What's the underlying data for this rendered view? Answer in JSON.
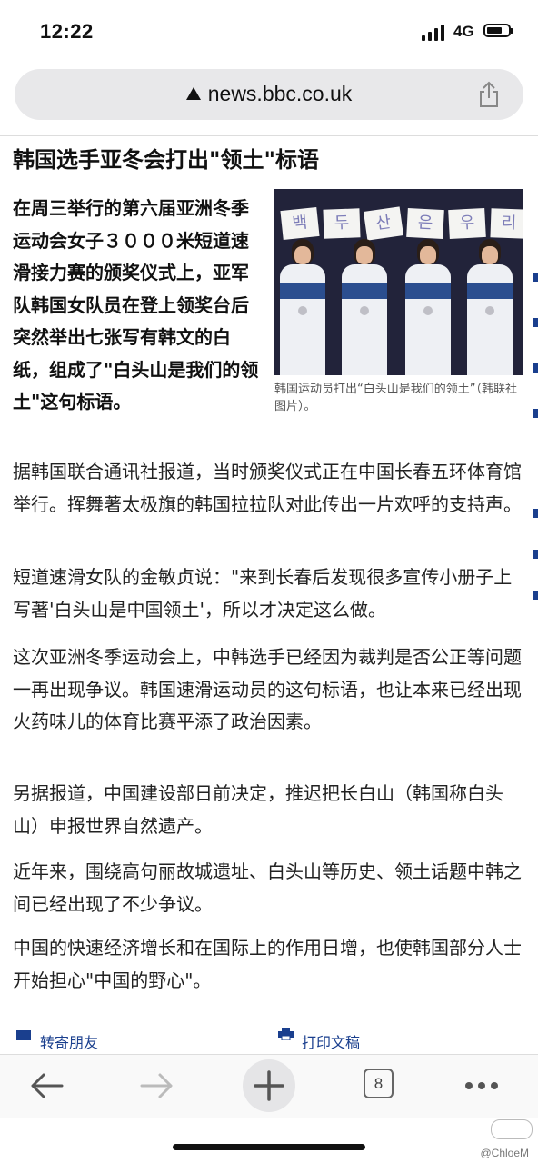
{
  "status_bar": {
    "time": "12:22",
    "network": "4G"
  },
  "browser": {
    "url": "news.bbc.co.uk",
    "open_tabs": "8"
  },
  "article": {
    "title": "韩国选手亚冬会打出\"领土\"标语",
    "lead": "在周三举行的第六届亚洲冬季运动会女子３０００米短道速滑接力赛的颁奖仪式上，亚军队韩国女队员在登上领奖台后突然举出七张写有韩文的白纸，组成了\"白头山是我们的领土\"这句标语。",
    "photo": {
      "banner_chars": [
        "백",
        "두",
        "산",
        "은",
        "우",
        "리"
      ],
      "caption": "韩国运动员打出“白头山是我们的领土”（韩联社图片）。"
    },
    "paragraphs": [
      "据韩国联合通讯社报道，当时颁奖仪式正在中国长春五环体育馆举行。挥舞著太极旗的韩国拉拉队对此传出一片欢呼的支持声。",
      "短道速滑女队的金敏贞说：\"来到长春后发现很多宣传小册子上写著'白头山是中国领土'，所以才决定这么做。",
      "这次亚洲冬季运动会上，中韩选手已经因为裁判是否公正等问题一再出现争议。韩国速滑运动员的这句标语，也让本来已经出现火药味儿的体育比赛平添了政治因素。",
      "另据报道，中国建设部日前决定，推迟把长白山（韩国称白头山）申报世界自然遗产。",
      "近年来，围绕高句丽故城遗址、白头山等历史、领土话题中韩之间已经出现了不少争议。",
      "中国的快速经济增长和在国际上的作用日增，也使韩国部分人士开始担心\"中国的野心\"。"
    ],
    "links": {
      "forward": "转寄朋友",
      "print": "打印文稿"
    }
  },
  "watermark": "@ChloeM",
  "colors": {
    "link": "#1a3f8e",
    "urlbar": "#e8e8ea"
  }
}
